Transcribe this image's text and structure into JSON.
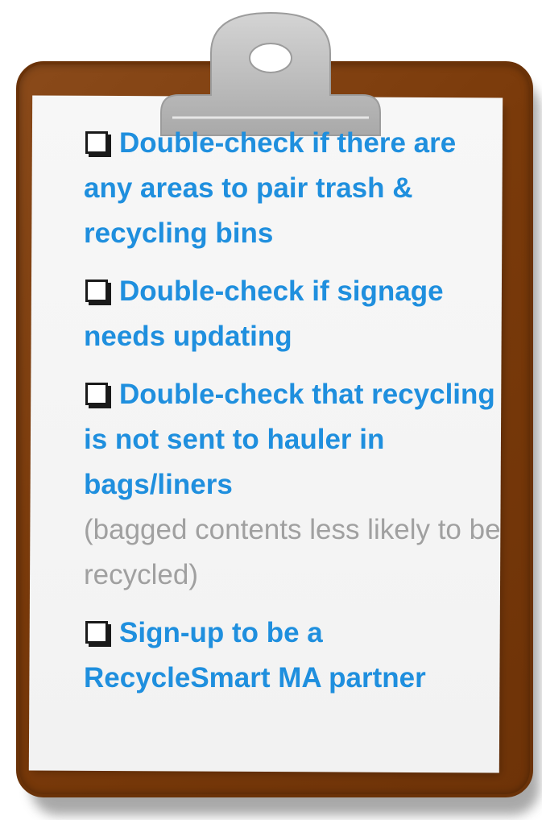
{
  "checklist": {
    "items": [
      {
        "label": "Double-check if there are any areas to pair trash & recycling bins",
        "note": "",
        "checked": false
      },
      {
        "label": "Double-check if signage needs updating",
        "note": "",
        "checked": false
      },
      {
        "label": "Double-check that recycling is not sent to hauler in bags/liners",
        "note": "(bagged contents less likely to be recycled)",
        "checked": false
      },
      {
        "label": "Sign-up to be a RecycleSmart MA partner",
        "note": "",
        "checked": false
      }
    ]
  },
  "colors": {
    "board": "#7a3a0a",
    "paper": "#f5f5f5",
    "item_text": "#1f8fde",
    "note_text": "#a0a0a0",
    "clip": "#bdbdbd"
  },
  "icons": {
    "clip": "clipboard-clip-icon",
    "checkbox": "empty-checkbox-icon"
  }
}
